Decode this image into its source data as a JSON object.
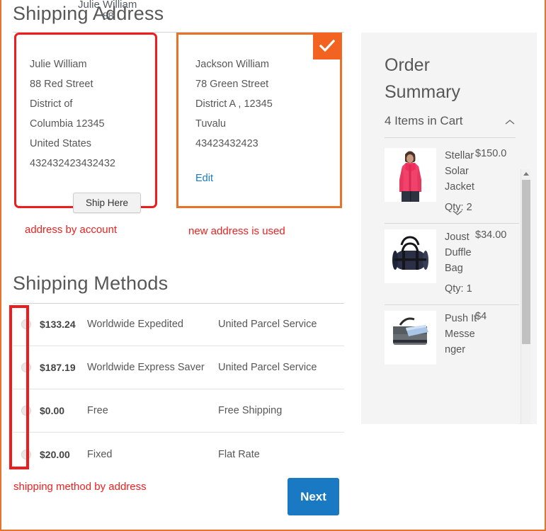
{
  "page": {
    "border_color": "#e8732a",
    "stray_overlay_name": "Julie William",
    "stray_overlay_number": "88"
  },
  "shipping_address": {
    "title": "Shipping Address",
    "cards": [
      {
        "id": "account-address",
        "highlight_color": "#ee1c1c",
        "name": "Julie William",
        "street": "88 Red Street",
        "city_line_1": "District of",
        "city_line_2": "Columbia 12345",
        "country": "United States",
        "phone": "432432423432432",
        "ship_here_label": "Ship Here"
      },
      {
        "id": "new-address",
        "highlight_color": "#e8722a",
        "name": "Jackson William",
        "street": "78 Green Street",
        "region_line": "District A   , 12345",
        "country": "Tuvalu",
        "phone": "43423432423",
        "edit_label": "Edit",
        "selected": true,
        "badge_icon": "check-icon",
        "badge_color": "#f26322"
      }
    ],
    "annotations": {
      "account": "address by account",
      "new": "new address is used"
    }
  },
  "shipping_methods": {
    "title": "Shipping Methods",
    "annotation": "shipping method by address",
    "rows": [
      {
        "price": "$133.24",
        "method": "Worldwide Expedited",
        "carrier": "United Parcel Service",
        "selected": false
      },
      {
        "price": "$187.19",
        "method": "Worldwide Express Saver",
        "carrier": "United Parcel Service",
        "selected": false
      },
      {
        "price": "$0.00",
        "method": "Free",
        "carrier": "Free Shipping",
        "selected": false
      },
      {
        "price": "$20.00",
        "method": "Fixed",
        "carrier": "Flat Rate",
        "selected": false
      }
    ]
  },
  "actions": {
    "next_label": "Next",
    "next_color": "#1979c3"
  },
  "order_summary": {
    "title": "Order Summary",
    "items_toggle_label": "4 Items in Cart",
    "toggle_icon": "chevron-up-icon",
    "items": [
      {
        "name": "Stellar Solar Jacket",
        "price": "$150.0",
        "qty_label": "Qty: 2",
        "thumb": "pink-jacket-photo",
        "has_expand": true,
        "expand_icon": "chevron-down-icon"
      },
      {
        "name": "Joust Duffle Bag",
        "price": "$34.00",
        "qty_label": "Qty: 1",
        "thumb": "navy-duffle-bag-photo",
        "has_expand": false
      },
      {
        "name": "Push It Messenger",
        "price": "$4",
        "qty_label": "",
        "thumb": "messenger-bag-photo",
        "has_expand": false
      }
    ],
    "scrollbars": {
      "vertical": "visible",
      "horizontal": "visible"
    }
  }
}
